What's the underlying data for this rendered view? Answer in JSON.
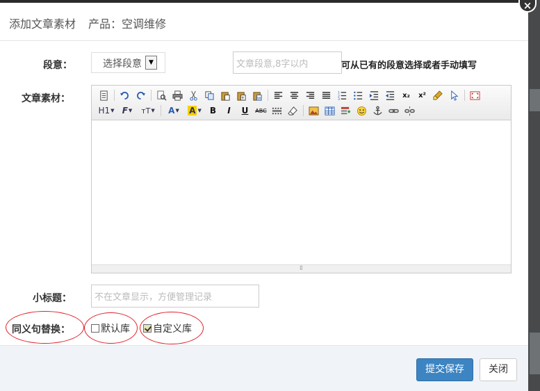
{
  "modal": {
    "close_glyph": "×",
    "title": "添加文章素材",
    "product_text": "产品：空调维修"
  },
  "form": {
    "paragraph_label": "段意：",
    "paragraph_select_value": "选择段意",
    "paragraph_input_placeholder": "文章段意,8字以内",
    "paragraph_hint": "可从已有的段意选择或者手动填写",
    "content_label": "文章素材：",
    "subtitle_label": "小标题：",
    "subtitle_placeholder": "不在文章显示，方便管理记录",
    "synonym_label": "同义句替换：",
    "default_lib_label": "默认库",
    "default_lib_checked": false,
    "custom_lib_label": "自定义库",
    "custom_lib_checked": true
  },
  "editor": {
    "toolbar_row2_text": {
      "heading": "H1",
      "font_family": "F",
      "font_size": "тT",
      "font_color": "A",
      "highlight": "A",
      "bold": "B",
      "italic": "I",
      "underline": "U",
      "strike": "ABC",
      "subscript": "x₂",
      "superscript": "x²"
    }
  },
  "footer": {
    "submit_label": "提交保存",
    "close_label": "关闭"
  },
  "colors": {
    "primary_button": "#3c84c2",
    "annotation_red": "#e0202a"
  }
}
